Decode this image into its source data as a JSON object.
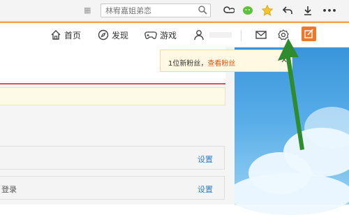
{
  "browser": {
    "search_placeholder": "林宥嘉姐弟恋",
    "qr_glyph": "▦",
    "icons": [
      "search-icon",
      "weather-icon",
      "wechat-icon",
      "star-icon",
      "back-icon",
      "download-icon",
      "more-icon"
    ],
    "more_label": "•••"
  },
  "nav": {
    "home": "首页",
    "discover": "发现",
    "games": "游戏",
    "user_name": "",
    "icons": [
      "home-icon",
      "compass-icon",
      "gamepad-icon",
      "user-icon",
      "mail-icon",
      "gear-icon",
      "compose-icon"
    ]
  },
  "popup": {
    "text": "1位新粉丝，",
    "link": "查看粉丝",
    "close": "✕"
  },
  "rows": [
    {
      "label": "",
      "action": "设置"
    },
    {
      "label": "登录",
      "action": "设置"
    }
  ],
  "colors": {
    "accent_orange": "#f7a04a",
    "compose_orange": "#f0772a",
    "link_blue": "#2e7ec7",
    "arrow_green": "#2e8b2e"
  }
}
